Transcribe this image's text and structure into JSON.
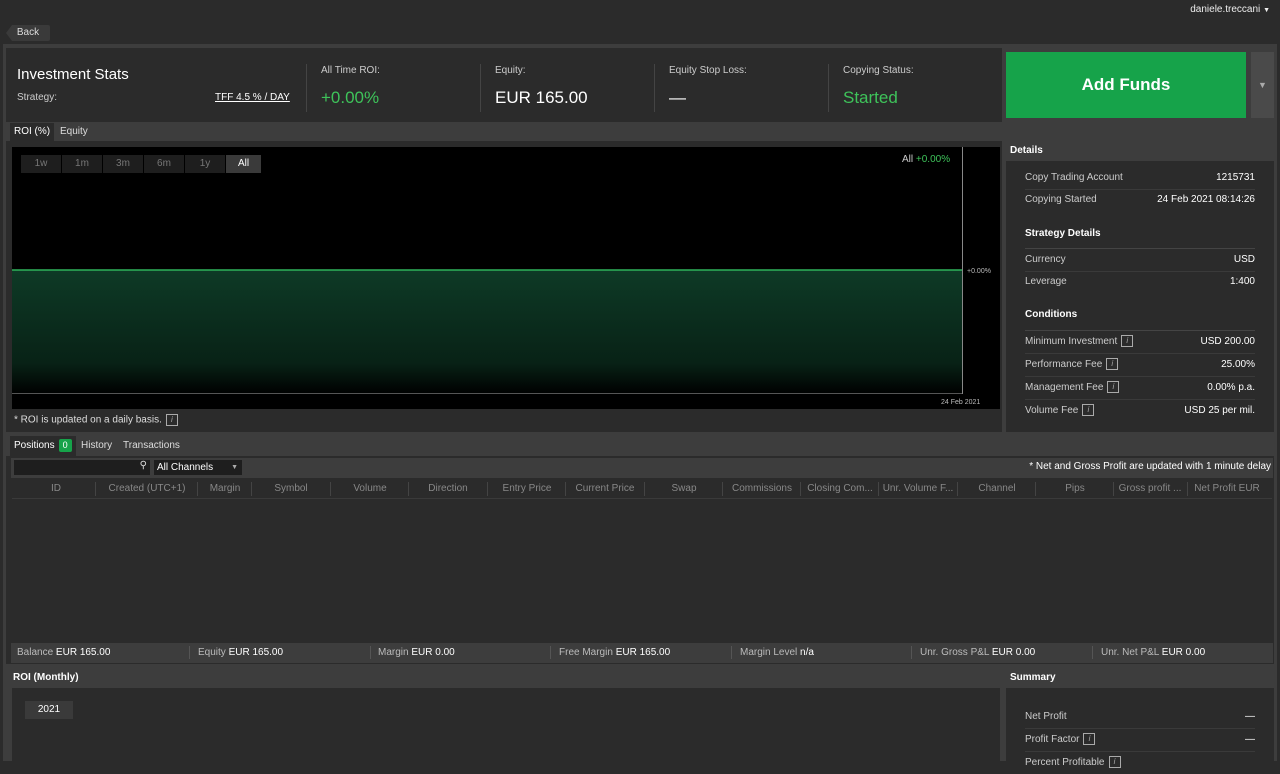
{
  "topbar": {
    "back_label": "Back",
    "username": "daniele.treccani"
  },
  "stats": {
    "title": "Investment Stats",
    "strategy_label": "Strategy:",
    "strategy_value": "TFF 4.5 % / DAY",
    "roi_label": "All Time ROI:",
    "roi_value": "+0.00%",
    "equity_label": "Equity:",
    "equity_value": "EUR 165.00",
    "stoploss_label": "Equity Stop Loss:",
    "stoploss_value": "—",
    "status_label": "Copying Status:",
    "status_value": "Started",
    "add_funds_label": "Add Funds"
  },
  "chart_tabs": [
    "ROI (%)",
    "Equity"
  ],
  "chart": {
    "ranges": [
      "1w",
      "1m",
      "3m",
      "6m",
      "1y",
      "All"
    ],
    "active_range": "All",
    "legend_label": "All",
    "legend_value": "+0.00%",
    "note": "* ROI is updated on a daily basis."
  },
  "chart_data": {
    "type": "area",
    "x": [
      "24 Feb 2021"
    ],
    "y": [
      0.0
    ],
    "ylabel_tick": "+0.00%",
    "xtick": "24 Feb 2021",
    "series_color": "#2fb35a"
  },
  "details": {
    "header": "Details",
    "account_label": "Copy Trading Account",
    "account_value": "1215731",
    "started_label": "Copying Started",
    "started_value": "24 Feb 2021 08:14:26",
    "strategy_section": "Strategy Details",
    "currency_label": "Currency",
    "currency_value": "USD",
    "leverage_label": "Leverage",
    "leverage_value": "1:400",
    "conditions_section": "Conditions",
    "min_inv_label": "Minimum Investment",
    "min_inv_value": "USD 200.00",
    "perf_fee_label": "Performance Fee",
    "perf_fee_value": "25.00%",
    "mgmt_fee_label": "Management Fee",
    "mgmt_fee_value": "0.00% p.a.",
    "vol_fee_label": "Volume Fee",
    "vol_fee_value": "USD 25 per mil."
  },
  "positions": {
    "tabs": {
      "positions": "Positions",
      "positions_count": "0",
      "history": "History",
      "transactions": "Transactions"
    },
    "channel_select": "All Channels",
    "note": "* Net and Gross Profit are updated with 1 minute delay",
    "columns": [
      "ID",
      "Created (UTC+1)",
      "Margin",
      "Symbol",
      "Volume",
      "Direction",
      "Entry Price",
      "Current Price",
      "Swap",
      "Commissions",
      "Closing Com...",
      "Unr. Volume F...",
      "Channel",
      "Pips",
      "Gross profit ...",
      "Net Profit EUR"
    ]
  },
  "balance": {
    "balance_label": "Balance",
    "balance_value": "EUR 165.00",
    "equity_label": "Equity",
    "equity_value": "EUR 165.00",
    "margin_label": "Margin",
    "margin_value": "EUR 0.00",
    "free_margin_label": "Free Margin",
    "free_margin_value": "EUR 165.00",
    "margin_level_label": "Margin Level",
    "margin_level_value": "n/a",
    "unr_gross_label": "Unr. Gross P&L",
    "unr_gross_value": "EUR 0.00",
    "unr_net_label": "Unr. Net P&L",
    "unr_net_value": "EUR 0.00"
  },
  "roi_monthly": {
    "header": "ROI (Monthly)",
    "year": "2021"
  },
  "summary": {
    "header": "Summary",
    "net_profit_label": "Net Profit",
    "net_profit_value": "—",
    "profit_factor_label": "Profit Factor",
    "profit_factor_value": "—",
    "percent_profitable_label": "Percent Profitable"
  }
}
